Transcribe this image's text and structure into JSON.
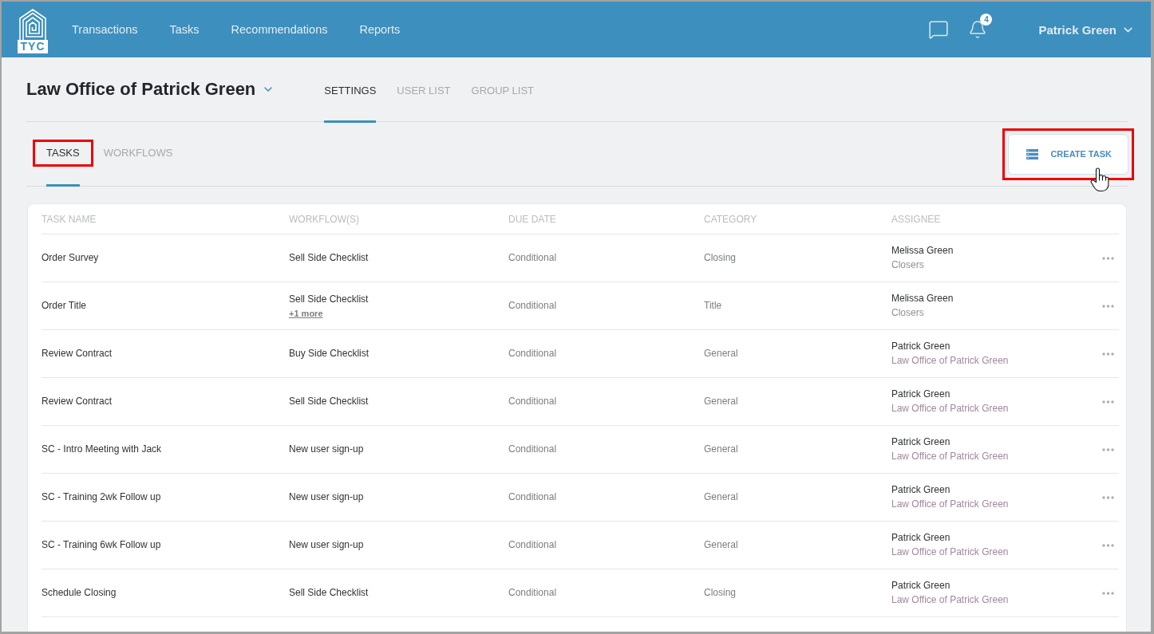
{
  "top_nav": {
    "logo_text": "TYC",
    "links": [
      {
        "label": "Transactions"
      },
      {
        "label": "Tasks"
      },
      {
        "label": "Recommendations"
      },
      {
        "label": "Reports"
      }
    ],
    "notification_count": "4",
    "user_name": "Patrick Green"
  },
  "header": {
    "organization": "Law Office of Patrick Green",
    "tabs": [
      {
        "label": "SETTINGS",
        "selected": true
      },
      {
        "label": "USER LIST",
        "selected": false
      },
      {
        "label": "GROUP LIST",
        "selected": false
      }
    ]
  },
  "sub_tabs": [
    {
      "label": "TASKS",
      "selected": true,
      "highlighted": true
    },
    {
      "label": "WORKFLOWS",
      "selected": false,
      "highlighted": false
    }
  ],
  "create_button": {
    "label": "CREATE TASK",
    "highlighted": true
  },
  "table": {
    "columns": [
      "TASK NAME",
      "WORKFLOW(S)",
      "DUE DATE",
      "CATEGORY",
      "ASSIGNEE"
    ],
    "rows": [
      {
        "task_name": "Order Survey",
        "workflow": "Sell Side Checklist",
        "due_date": "Conditional",
        "category": "Closing",
        "assignee": {
          "name": "Melissa Green",
          "group": "Closers",
          "kind": "group"
        }
      },
      {
        "task_name": "Order Title",
        "workflow": "Sell Side Checklist",
        "more_link": "+1 more",
        "due_date": "Conditional",
        "category": "Title",
        "assignee": {
          "name": "Melissa Green",
          "group": "Closers",
          "kind": "group"
        }
      },
      {
        "task_name": "Review Contract",
        "workflow": "Buy Side Checklist",
        "due_date": "Conditional",
        "category": "General",
        "assignee": {
          "name": "Patrick Green",
          "group": "Law Office of Patrick Green",
          "kind": "office"
        }
      },
      {
        "task_name": "Review Contract",
        "workflow": "Sell Side Checklist",
        "due_date": "Conditional",
        "category": "General",
        "assignee": {
          "name": "Patrick Green",
          "group": "Law Office of Patrick Green",
          "kind": "office"
        }
      },
      {
        "task_name": "SC - Intro Meeting with Jack",
        "workflow": "New user sign-up",
        "due_date": "Conditional",
        "category": "General",
        "assignee": {
          "name": "Patrick Green",
          "group": "Law Office of Patrick Green",
          "kind": "office"
        }
      },
      {
        "task_name": "SC - Training 2wk Follow up",
        "workflow": "New user sign-up",
        "due_date": "Conditional",
        "category": "General",
        "assignee": {
          "name": "Patrick Green",
          "group": "Law Office of Patrick Green",
          "kind": "office"
        }
      },
      {
        "task_name": "SC - Training 6wk Follow up",
        "workflow": "New user sign-up",
        "due_date": "Conditional",
        "category": "General",
        "assignee": {
          "name": "Patrick Green",
          "group": "Law Office of Patrick Green",
          "kind": "office"
        }
      },
      {
        "task_name": "Schedule Closing",
        "workflow": "Sell Side Checklist",
        "due_date": "Conditional",
        "category": "Closing",
        "assignee": {
          "name": "Patrick Green",
          "group": "Law Office of Patrick Green",
          "kind": "office"
        }
      }
    ]
  }
}
